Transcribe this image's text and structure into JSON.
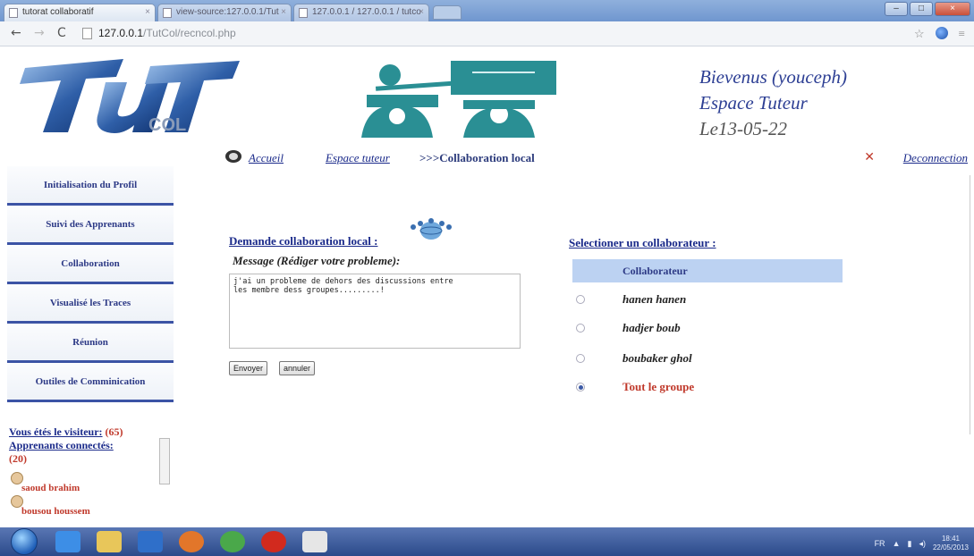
{
  "browser": {
    "tabs": [
      {
        "label": "tutorat collaboratif",
        "active": true
      },
      {
        "label": "view-source:127.0.0.1/Tut",
        "active": false
      },
      {
        "label": "127.0.0.1 / 127.0.0.1 / tutco",
        "active": false
      }
    ],
    "url_host": "127.0.0.1",
    "url_path": "/TutCol/recncol.php"
  },
  "header": {
    "logo_text": "TuT",
    "logo_sub": "COL",
    "welcome": "Bievenus (youceph)",
    "space": "Espace Tuteur",
    "date": "Le13-05-22"
  },
  "breadcrumb": {
    "home": "Accueil",
    "space": "Espace tuteur",
    "current": ">>>Collaboration local",
    "logout": "Deconnection"
  },
  "sidebar": {
    "items": [
      {
        "label": "Initialisation du Profil"
      },
      {
        "label": "Suivi des Apprenants"
      },
      {
        "label": "Collaboration"
      },
      {
        "label": "Visualisé les Traces"
      },
      {
        "label": "Réunion"
      },
      {
        "label": "Outiles de Comminication"
      }
    ],
    "visitor_label": "Vous étés le visiteur:",
    "visitor_count": "(65)",
    "connected_label": "Apprenants connectés:",
    "connected_count": "(20)",
    "users": [
      {
        "name": "saoud brahim"
      },
      {
        "name": "bousou houssem"
      }
    ]
  },
  "form": {
    "title": "Demande collaboration local :",
    "message_label": "Message (Rédiger votre probleme):",
    "message_value": "j'ai un probleme de dehors des discussions entre\nles membre dess groupes.........!",
    "send_label": "Envoyer",
    "cancel_label": "annuler"
  },
  "collaborators": {
    "title": "Selectioner un collaborateur :",
    "column_header": "Collaborateur",
    "rows": [
      {
        "name": "hanen hanen",
        "selected": false
      },
      {
        "name": "hadjer boub",
        "selected": false
      },
      {
        "name": "boubaker ghol",
        "selected": false
      },
      {
        "name": "Tout le groupe",
        "selected": true
      }
    ]
  },
  "taskbar": {
    "lang": "FR",
    "time": "18:41",
    "date": "22/05/2013"
  },
  "colors": {
    "link": "#1a2a8a",
    "accent_red": "#c0392b",
    "header_blue": "#bcd2f2",
    "sidebar_rule": "#3b53a5"
  }
}
